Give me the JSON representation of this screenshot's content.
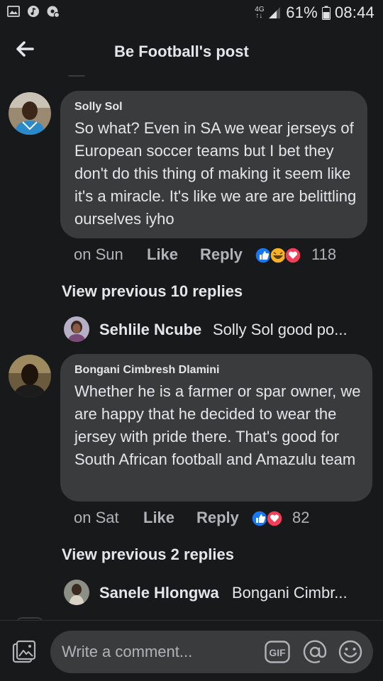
{
  "status_bar": {
    "network": "4G",
    "network_sub": "↑↓",
    "battery": "61%",
    "time": "08:44"
  },
  "header": {
    "title": "Be Football's post"
  },
  "comments": [
    {
      "author": "Solly Sol",
      "text": "So what? Even in SA we wear jerseys of European soccer teams but I bet they don't do this thing of making it seem like it's a miracle. It's like we are are belittling ourselves iyho",
      "time": "on Sun",
      "like_label": "Like",
      "reply_label": "Reply",
      "reactions": [
        "like",
        "haha",
        "love"
      ],
      "reaction_count": "118",
      "view_previous": "View previous 10 replies",
      "latest_reply": {
        "name": "Sehlile Ncube",
        "text": "Solly Sol good po..."
      }
    },
    {
      "author": "Bongani Cimbresh Dlamini",
      "text": "Whether he is a farmer or spar owner, we are happy that he decided to wear the jersey with pride there. That's good for South African football and Amazulu team",
      "time": "on Sat",
      "like_label": "Like",
      "reply_label": "Reply",
      "reactions": [
        "like",
        "love"
      ],
      "reaction_count": "82",
      "view_previous": "View previous 2 replies",
      "latest_reply": {
        "name": "Sanele Hlongwa",
        "text": "Bongani Cimbr..."
      }
    }
  ],
  "composer": {
    "placeholder": "Write a comment...",
    "gif_label": "GIF"
  },
  "colors": {
    "background": "#18191a",
    "bubble": "#3a3b3c",
    "text_primary": "#e4e6eb",
    "text_secondary": "#b0b3b8",
    "like_blue": "#1877f2",
    "love_red": "#f33e58",
    "haha_yellow": "#f7b125"
  }
}
